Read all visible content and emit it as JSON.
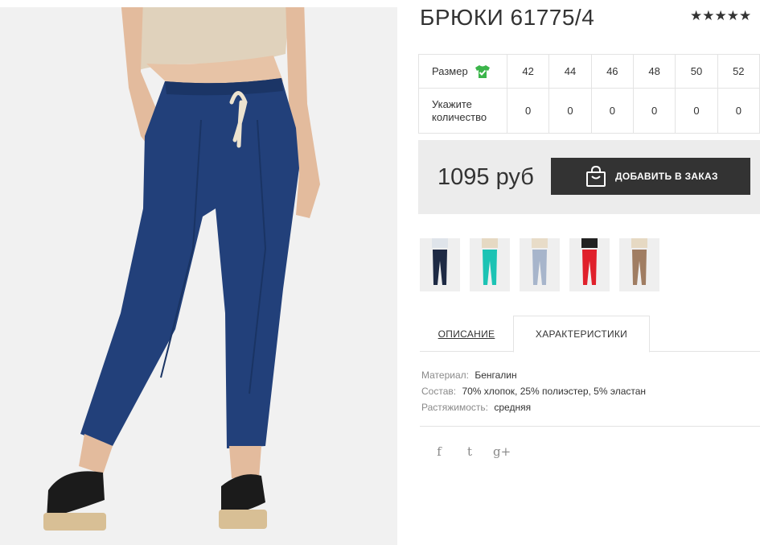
{
  "product": {
    "title": "БРЮКИ 61775/4",
    "rating_stars": "★★★★★"
  },
  "sizes": {
    "size_label": "Размер",
    "qty_label": "Укажите количество",
    "list": [
      "42",
      "44",
      "46",
      "48",
      "50",
      "52"
    ],
    "quantities": [
      "0",
      "0",
      "0",
      "0",
      "0",
      "0"
    ]
  },
  "purchase": {
    "price": "1095 руб",
    "button_label": "ДОБАВИТЬ В ЗАКАЗ"
  },
  "thumbnails": [
    {
      "name": "dark-navy",
      "color": "#1e2a44"
    },
    {
      "name": "turquoise",
      "color": "#1cc3b4"
    },
    {
      "name": "light-grey-blue",
      "color": "#a7b5cb"
    },
    {
      "name": "red",
      "color": "#e0202b"
    },
    {
      "name": "mocha",
      "color": "#a07d62"
    }
  ],
  "tabs": {
    "description": "ОПИСАНИЕ",
    "specs": "ХАРАКТЕРИСТИКИ"
  },
  "specs": {
    "material_key": "Материал:",
    "material_val": "Бенгалин",
    "composition_key": "Состав:",
    "composition_val": "70% хлопок, 25% полиэстер, 5% эластан",
    "stretch_key": "Растяжимость:",
    "stretch_val": "средняя"
  },
  "social": {
    "facebook": "f",
    "twitter": "t",
    "googleplus": "g+"
  },
  "colors": {
    "pants": "#22407a",
    "button": "#333333",
    "price_bg": "#ececec",
    "size_icon": "#3bb54a"
  }
}
